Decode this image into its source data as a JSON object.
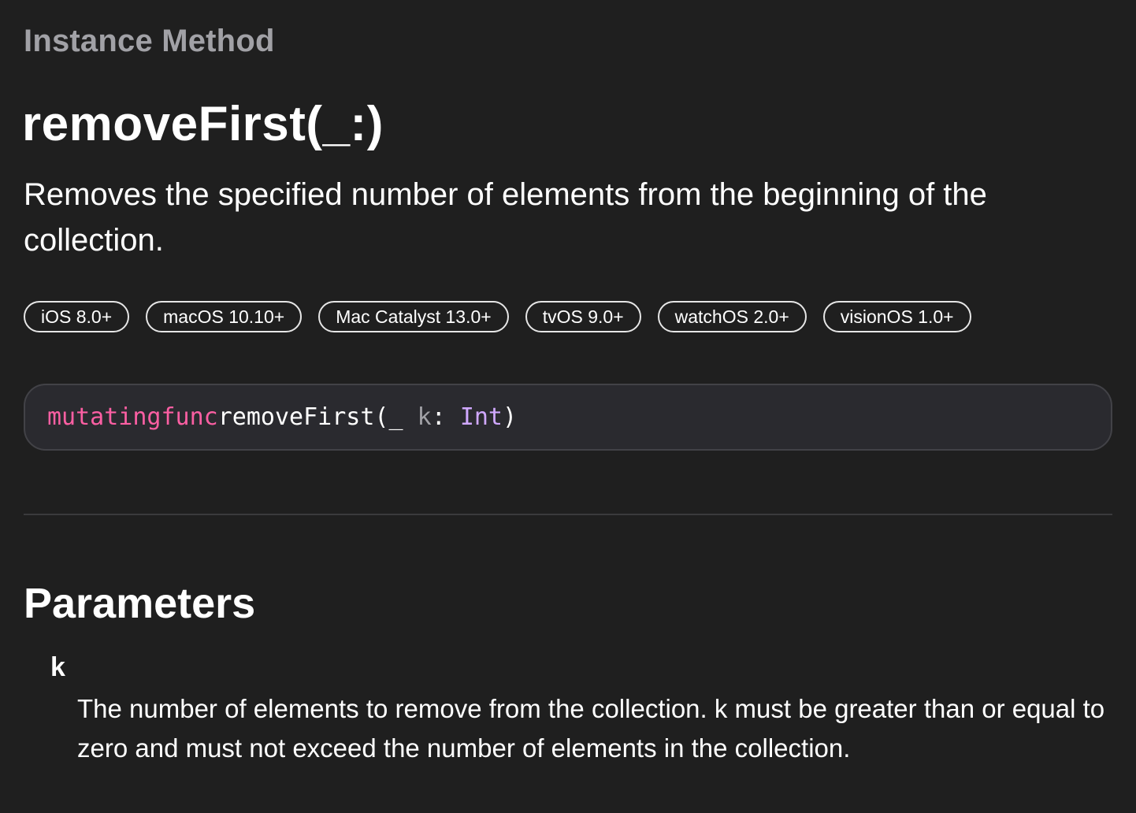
{
  "header": {
    "eyebrow": "Instance Method",
    "title": "removeFirst(_:)",
    "abstract": "Removes the specified number of elements from the beginning of the collection."
  },
  "platforms": [
    {
      "label": "iOS 8.0+"
    },
    {
      "label": "macOS 10.10+"
    },
    {
      "label": "Mac Catalyst 13.0+"
    },
    {
      "label": "tvOS 9.0+"
    },
    {
      "label": "watchOS 2.0+"
    },
    {
      "label": "visionOS 1.0+"
    }
  ],
  "declaration": {
    "keyword1": "mutating",
    "keyword2": "func",
    "name": "removeFirst(_ ",
    "param": "k",
    "colon": ": ",
    "type": "Int",
    "close": ")"
  },
  "parameters": {
    "heading": "Parameters",
    "items": [
      {
        "name": "k",
        "description": "The number of elements to remove from the collection. k must be greater than or equal to zero and must not exceed the number of elements in the collection."
      }
    ]
  },
  "colors": {
    "background": "#1f1f1f",
    "keyword": "#fc5fa3",
    "type": "#d0a8ff",
    "eyebrow": "#a1a1a6"
  }
}
